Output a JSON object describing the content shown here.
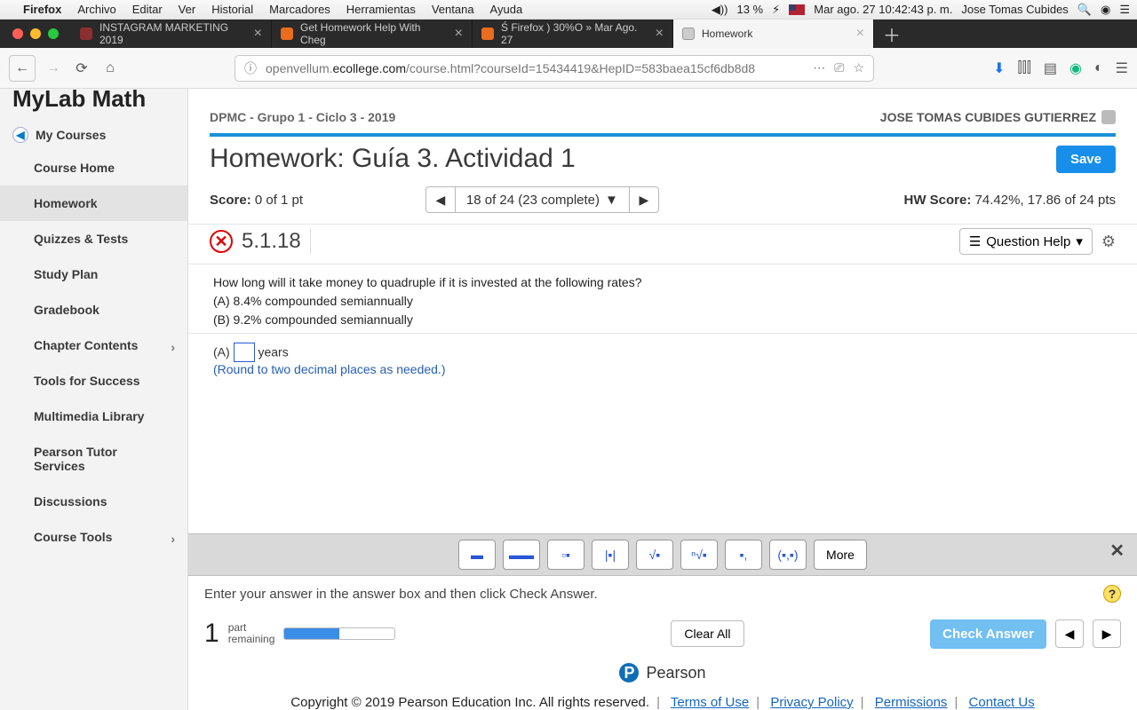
{
  "menubar": {
    "app": "Firefox",
    "items": [
      "Archivo",
      "Editar",
      "Ver",
      "Historial",
      "Marcadores",
      "Herramientas",
      "Ventana",
      "Ayuda"
    ],
    "battery": "13 %",
    "date": "Mar ago. 27  10:42:43 p. m.",
    "user": "Jose Tomas Cubides"
  },
  "tabs": [
    {
      "label": "INSTAGRAM MARKETING 2019"
    },
    {
      "label": "Get Homework Help With Cheg"
    },
    {
      "label": "Ś Firefox ) 30%O » Mar Ago. 27"
    },
    {
      "label": "Homework",
      "active": true
    }
  ],
  "url": {
    "prefix": "openvellum.",
    "host": "ecollege.com",
    "path": "/course.html?courseId=15434419&HepID=583baea15cf6db8d8"
  },
  "sidebar": {
    "brand": "MyLab Math",
    "my_courses": "My Courses",
    "items": [
      {
        "label": "Course Home"
      },
      {
        "label": "Homework",
        "active": true
      },
      {
        "label": "Quizzes & Tests"
      },
      {
        "label": "Study Plan"
      },
      {
        "label": "Gradebook"
      },
      {
        "label": "Chapter Contents",
        "chev": true
      },
      {
        "label": "Tools for Success"
      },
      {
        "label": "Multimedia Library"
      },
      {
        "label": "Pearson Tutor Services"
      },
      {
        "label": "Discussions"
      },
      {
        "label": "Course Tools",
        "chev": true
      }
    ]
  },
  "header": {
    "crumb": "DPMC - Grupo 1 - Ciclo 3 - 2019",
    "user": "JOSE TOMAS CUBIDES GUTIERREZ",
    "title": "Homework: Guía 3. Actividad 1",
    "save": "Save"
  },
  "score": {
    "label": "Score:",
    "value": "0 of 1 pt",
    "stepper": "18 of 24 (23 complete)",
    "hw_label": "HW Score:",
    "hw_value": "74.42%, 17.86 of 24 pts"
  },
  "question": {
    "number": "5.1.18",
    "help": "Question Help",
    "lines": [
      "How long will it take money to quadruple if it is invested at the following rates?",
      "(A) 8.4% compounded semiannually",
      "(B) 9.2% compounded semiannually"
    ],
    "answer_prefix": "(A)",
    "answer_suffix": "years",
    "note": "(Round to two decimal places as needed.)"
  },
  "toolbar": {
    "more": "More"
  },
  "hint": "Enter your answer in the answer box and then click Check Answer.",
  "footer": {
    "parts_num": "1",
    "parts_a": "part",
    "parts_b": "remaining",
    "clear": "Clear All",
    "check": "Check Answer"
  },
  "pearson": "Pearson",
  "legal": {
    "copy": "Copyright © 2019 Pearson Education Inc. All rights reserved.",
    "links": [
      "Terms of Use",
      "Privacy Policy",
      "Permissions",
      "Contact Us"
    ]
  }
}
